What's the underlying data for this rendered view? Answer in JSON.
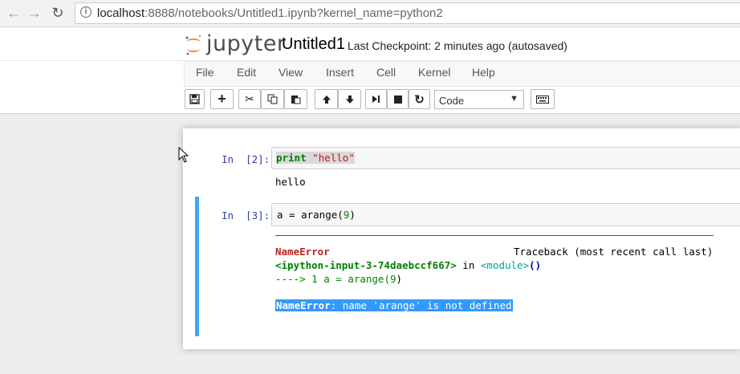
{
  "browser": {
    "url_host": "localhost",
    "url_path": ":8888/notebooks/Untitled1.ipynb?kernel_name=python2"
  },
  "header": {
    "logo_text": "jupyter",
    "notebook_name": "Untitled1",
    "checkpoint": "Last Checkpoint: 2 minutes ago (autosaved)"
  },
  "menu": [
    "File",
    "Edit",
    "View",
    "Insert",
    "Cell",
    "Kernel",
    "Help"
  ],
  "toolbar": {
    "cell_type": "Code"
  },
  "cells": [
    {
      "prompt": "In  [2]:",
      "code_keyword": "print",
      "code_string": "\"hello\"",
      "output": "hello"
    },
    {
      "prompt": "In  [3]:",
      "code_prefix": "a = arange(",
      "code_num": "9",
      "code_suffix": ")",
      "traceback": {
        "error_name": "NameError",
        "traceback_label": "Traceback (most recent call last)",
        "input_ref": "<ipython-input-3-74daebccf667>",
        "in_word": " in ",
        "module": "<module>",
        "module_parens": "()",
        "arrow_line_prefix": "----> 1 a = arange(",
        "arrow_num": "9",
        "arrow_suffix": ")",
        "final_error_name": "NameError",
        "final_error_msg": ": name 'arange' is not defined"
      }
    }
  ]
}
